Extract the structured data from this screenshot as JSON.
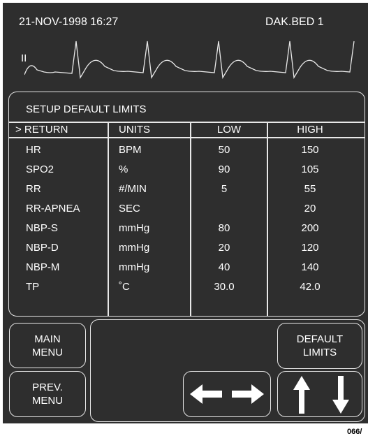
{
  "header": {
    "datetime": "21-NOV-1998  16:27",
    "bed": "DAK.BED 1"
  },
  "ecg": {
    "lead": "II"
  },
  "panel": {
    "title": "SETUP DEFAULT LIMITS",
    "columns": [
      "> RETURN",
      "UNITS",
      "LOW",
      "HIGH"
    ],
    "rows": [
      {
        "param": "HR",
        "unit": "BPM",
        "low": "50",
        "high": "150"
      },
      {
        "param": "SPO2",
        "unit": "%",
        "low": "90",
        "high": "105"
      },
      {
        "param": "RR",
        "unit": "#/MIN",
        "low": "5",
        "high": "55"
      },
      {
        "param": "RR-APNEA",
        "unit": "SEC",
        "low": "",
        "high": "20"
      },
      {
        "param": "NBP-S",
        "unit": "mmHg",
        "low": "80",
        "high": "200"
      },
      {
        "param": "NBP-D",
        "unit": "mmHg",
        "low": "20",
        "high": "120"
      },
      {
        "param": "NBP-M",
        "unit": "mmHg",
        "low": "40",
        "high": "140"
      },
      {
        "param": "TP",
        "unit": "˚C",
        "low": "30.0",
        "high": "42.0"
      }
    ]
  },
  "buttons": {
    "main_menu": [
      "MAIN",
      "MENU"
    ],
    "prev_menu": [
      "PREV.",
      "MENU"
    ],
    "default_limits": [
      "DEFAULT",
      "LIMITS"
    ]
  },
  "footer": {
    "code": "066/"
  }
}
